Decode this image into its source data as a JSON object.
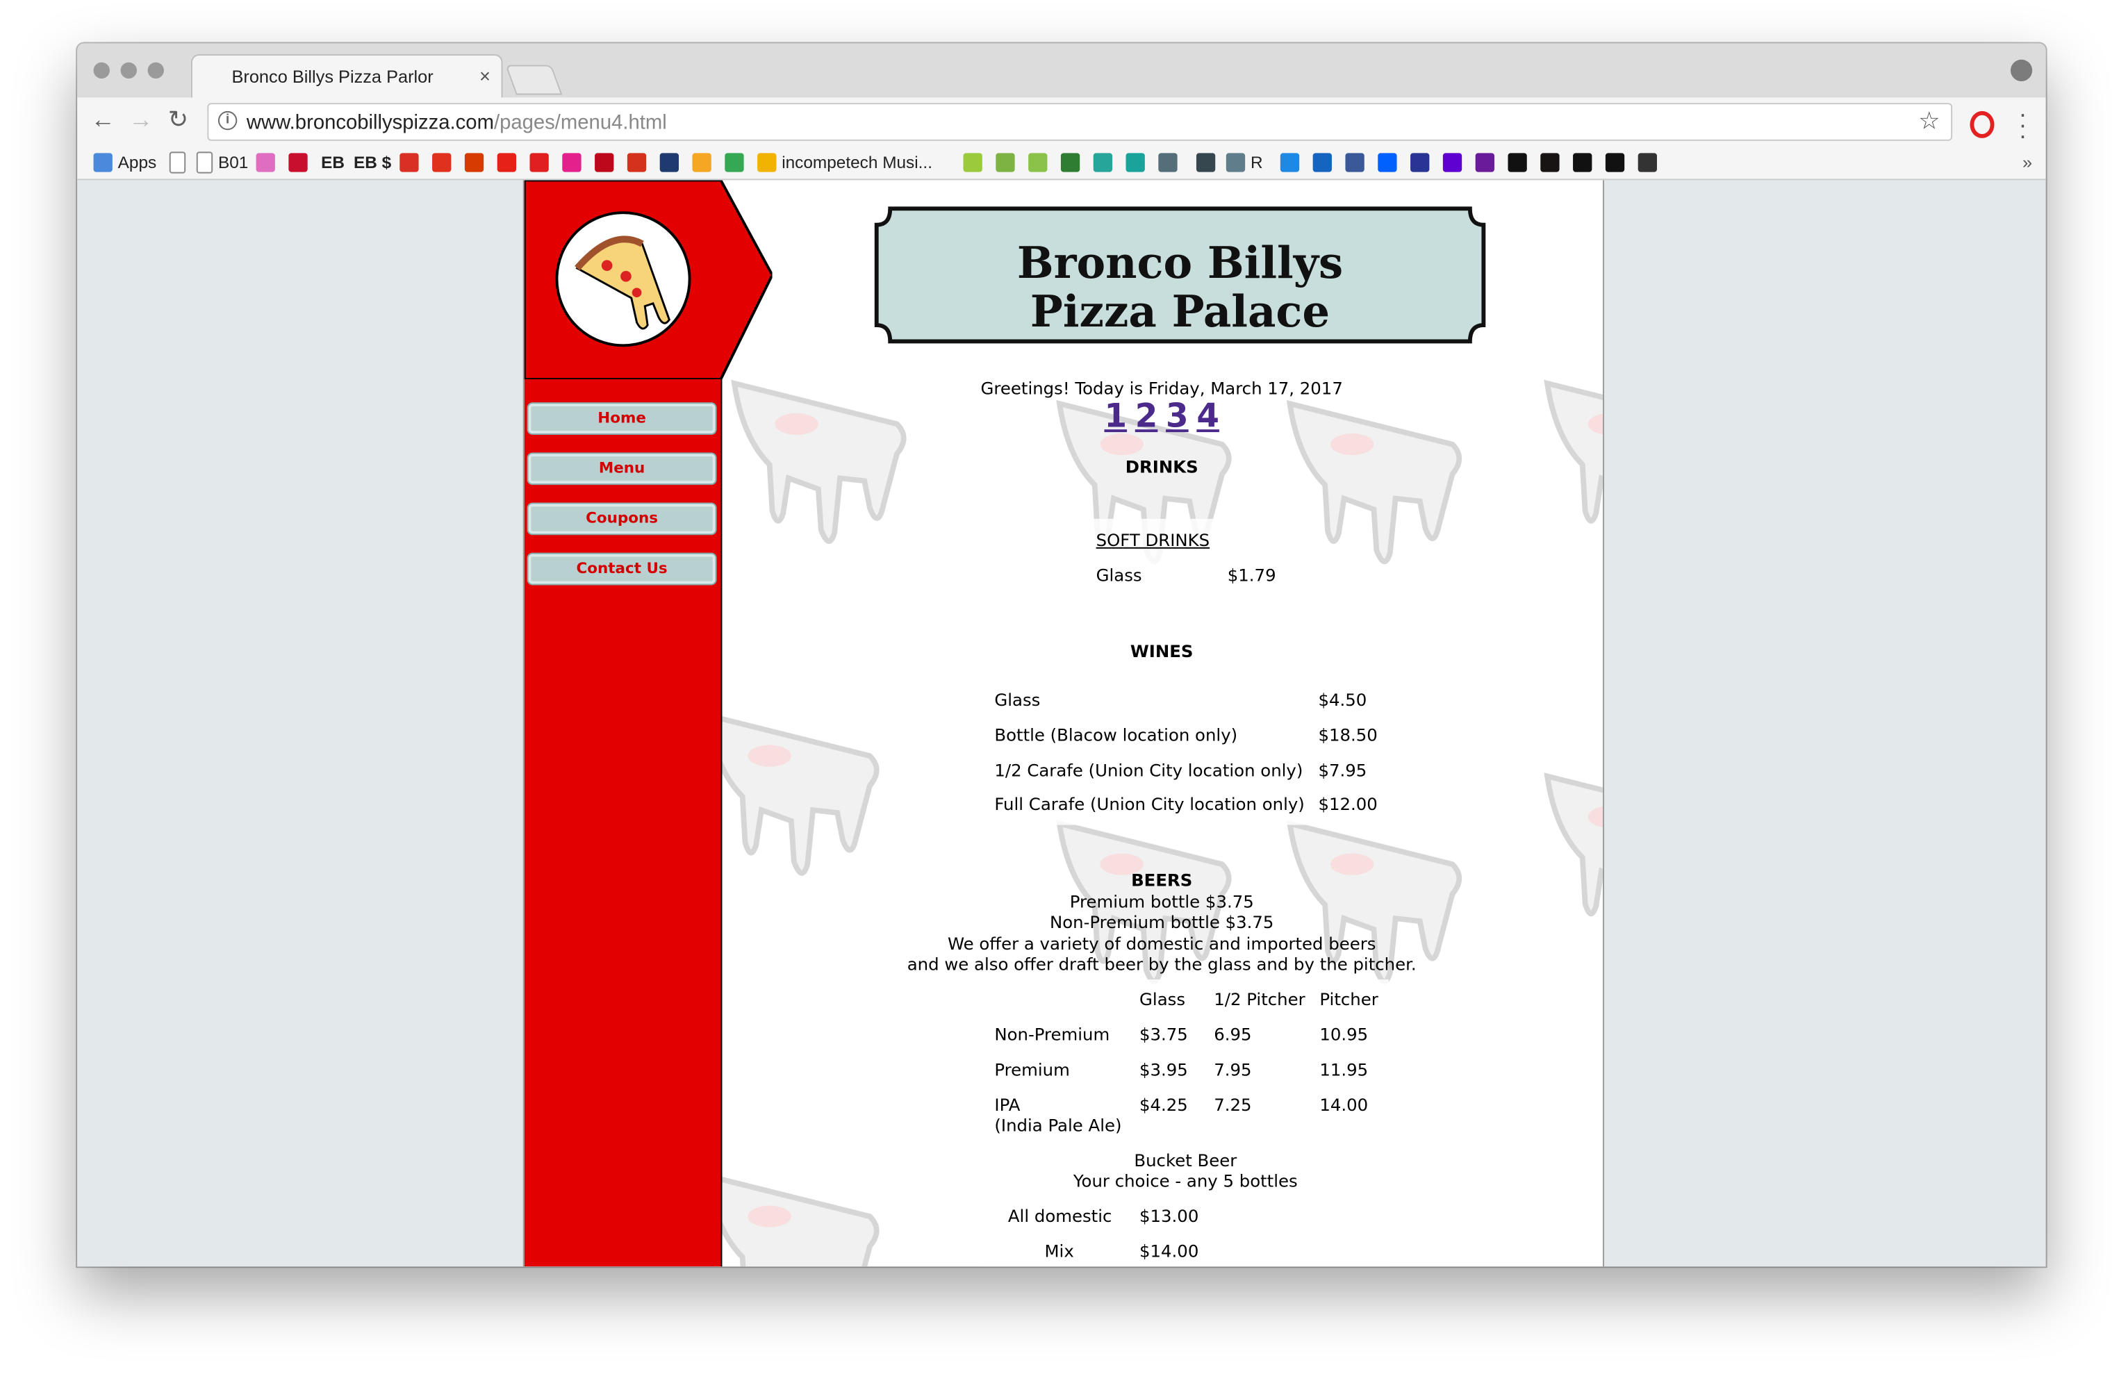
{
  "browser": {
    "tab_title": "Bronco Billys Pizza Parlor",
    "tab_close": "×",
    "url_host": "www.broncobillyspizza.com",
    "url_path": "/pages/menu4.html",
    "bookmarks": [
      {
        "label": "Apps",
        "icon": "apps-grid-icon",
        "color": "#4a89dc"
      },
      {
        "label": "",
        "icon": "page-icon",
        "color": "#ffffff"
      },
      {
        "label": "B01",
        "icon": "page-icon",
        "color": "#ffffff"
      },
      {
        "label": "",
        "icon": "bookmark-icon",
        "color": "#e06ec0"
      },
      {
        "label": "",
        "icon": "bank-icon",
        "color": "#c8102e"
      },
      {
        "label": "EB",
        "icon": "",
        "color": ""
      },
      {
        "label": "EB $",
        "icon": "",
        "color": ""
      },
      {
        "label": "",
        "icon": "gmail-icon",
        "color": "#d93025"
      },
      {
        "label": "",
        "icon": "adobe-icon",
        "color": "#e0301e"
      },
      {
        "label": "",
        "icon": "office-icon",
        "color": "#d83b01"
      },
      {
        "label": "",
        "icon": "youtube-icon",
        "color": "#e62117"
      },
      {
        "label": "",
        "icon": "record-icon",
        "color": "#e02020"
      },
      {
        "label": "",
        "icon": "p-icon",
        "color": "#e4208c"
      },
      {
        "label": "",
        "icon": "pinterest-icon",
        "color": "#bd081c"
      },
      {
        "label": "",
        "icon": "ui-icon",
        "color": "#d4321c"
      },
      {
        "label": "",
        "icon": "slash-icon",
        "color": "#1e3a6e"
      },
      {
        "label": "",
        "icon": "p-orange-icon",
        "color": "#f5a623"
      },
      {
        "label": "",
        "icon": "drive-icon",
        "color": "#34a853"
      },
      {
        "label": "incompetech Musi...",
        "icon": "play-icon",
        "color": "#f2b200"
      },
      {
        "label": "",
        "icon": "z-icon",
        "color": "#9bcb3c"
      },
      {
        "label": "",
        "icon": "w-icon",
        "color": "#7cb342"
      },
      {
        "label": "",
        "icon": "green-square-icon",
        "color": "#8bc34a"
      },
      {
        "label": "",
        "icon": "frog-icon",
        "color": "#2e7d32"
      },
      {
        "label": "",
        "icon": "s-icon",
        "color": "#26a69a"
      },
      {
        "label": "",
        "icon": "teal-square-icon",
        "color": "#1aa39a"
      },
      {
        "label": "",
        "icon": "cl-icon",
        "color": "#546e7a"
      },
      {
        "label": "",
        "icon": "calendar-icon",
        "color": "#37474f"
      },
      {
        "label": "R",
        "icon": "folder-icon",
        "color": "#607d8b"
      },
      {
        "label": "",
        "icon": "tu-icon",
        "color": "#1e88e5"
      },
      {
        "label": "",
        "icon": "circle-icon",
        "color": "#1565c0"
      },
      {
        "label": "",
        "icon": "facebook-icon",
        "color": "#3b5998"
      },
      {
        "label": "",
        "icon": "dropbox-icon",
        "color": "#0061ff"
      },
      {
        "label": "",
        "icon": "grid-icon",
        "color": "#283593"
      },
      {
        "label": "",
        "icon": "yahoo-icon",
        "color": "#5f01d1"
      },
      {
        "label": "",
        "icon": "peace-icon",
        "color": "#6a1b9a"
      },
      {
        "label": "",
        "icon": "github-icon",
        "color": "#111111"
      },
      {
        "label": "",
        "icon": "spotify-icon",
        "color": "#191414"
      },
      {
        "label": "",
        "icon": "d-icon",
        "color": "#111111"
      },
      {
        "label": "",
        "icon": "we-icon",
        "color": "#111111"
      },
      {
        "label": "",
        "icon": "bb-icon",
        "color": "#333333"
      }
    ],
    "bookmarks_overflow": "»"
  },
  "site": {
    "title_line1": "Bronco Billys",
    "title_line2": "Pizza Palace",
    "nav": [
      "Home",
      "Menu",
      "Coupons",
      "Contact Us"
    ],
    "greeting": "Greetings! Today is Friday, March 17, 2017",
    "pages": [
      "1",
      "2",
      "3",
      "4"
    ],
    "section_drinks": "DRINKS",
    "soft_drinks_heading": "SOFT DRINKS",
    "soft_drinks": [
      {
        "item": "Glass",
        "price": "$1.79"
      }
    ],
    "section_wines": "WINES",
    "wines": [
      {
        "item": "Glass",
        "price": "$4.50"
      },
      {
        "item": "Bottle (Blacow location only)",
        "price": "$18.50"
      },
      {
        "item": "1/2 Carafe (Union City location only)",
        "price": "$7.95"
      },
      {
        "item": "Full Carafe (Union City location only)",
        "price": "$12.00"
      }
    ],
    "section_beers": "BEERS",
    "beer_lines": [
      "Premium bottle $3.75",
      "Non-Premium bottle $3.75",
      "We offer a variety of domestic and imported beers",
      "and we also offer draft beer by the glass and by the pitcher."
    ],
    "beer_headers": [
      "Glass",
      "1/2 Pitcher",
      "Pitcher"
    ],
    "beers": [
      {
        "item": "Non-Premium",
        "item2": "",
        "glass": "$3.75",
        "half": "6.95",
        "pitcher": "10.95"
      },
      {
        "item": "Premium",
        "item2": "",
        "glass": "$3.95",
        "half": "7.95",
        "pitcher": "11.95"
      },
      {
        "item": "IPA",
        "item2": "(India Pale Ale)",
        "glass": "$4.25",
        "half": "7.25",
        "pitcher": "14.00"
      }
    ],
    "bucket_title": "Bucket Beer",
    "bucket_sub": "Your choice - any 5 bottles",
    "bucket": [
      {
        "item": "All domestic",
        "price": "$13.00"
      },
      {
        "item": "Mix",
        "price": "$14.00"
      }
    ]
  }
}
